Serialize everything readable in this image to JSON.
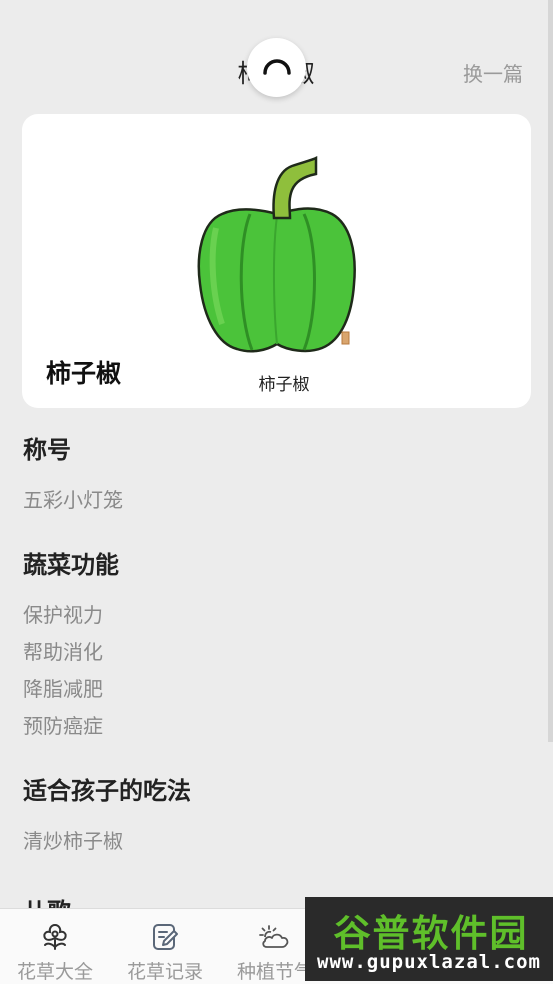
{
  "header": {
    "title": "柿子椒",
    "switch_label": "换一篇"
  },
  "card": {
    "name": "柿子椒",
    "illustration_caption": "柿子椒",
    "colors": {
      "pepper_green": "#4bc33a",
      "stem_green": "#8fbf3c"
    }
  },
  "sections": {
    "nickname": {
      "title": "称号",
      "items": [
        "五彩小灯笼"
      ]
    },
    "benefits": {
      "title": "蔬菜功能",
      "items": [
        "保护视力",
        "帮助消化",
        "降脂减肥",
        "预防癌症"
      ]
    },
    "kids_recipe": {
      "title": "适合孩子的吃法",
      "items": [
        "清炒柿子椒"
      ]
    },
    "song": {
      "title": "儿歌"
    }
  },
  "bottom_nav": {
    "items": [
      {
        "label": "花草大全",
        "icon": "flower-icon"
      },
      {
        "label": "花草记录",
        "icon": "edit-note-icon"
      },
      {
        "label": "种植节气",
        "icon": "weather-cloud-icon"
      }
    ]
  },
  "watermark": {
    "main": "谷普软件园",
    "sub": "www.gupuxlazal.com"
  }
}
